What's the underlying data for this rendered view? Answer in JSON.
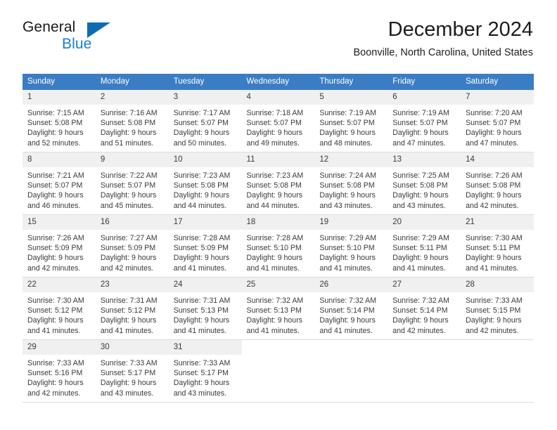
{
  "brand": {
    "name_part1": "General",
    "name_part2": "Blue",
    "accent_color": "#1a7fd4",
    "flag_color": "#0d6cb5"
  },
  "header": {
    "title": "December 2024",
    "subtitle": "Boonville, North Carolina, United States"
  },
  "theme": {
    "header_blue": "#3b7dc4",
    "daynum_bg": "#f0f0f0",
    "text": "#3a3a3a"
  },
  "weekday_headers": [
    "Sunday",
    "Monday",
    "Tuesday",
    "Wednesday",
    "Thursday",
    "Friday",
    "Saturday"
  ],
  "weeks": [
    {
      "days": [
        {
          "num": "1",
          "sunrise": "Sunrise: 7:15 AM",
          "sunset": "Sunset: 5:08 PM",
          "daylight1": "Daylight: 9 hours",
          "daylight2": "and 52 minutes."
        },
        {
          "num": "2",
          "sunrise": "Sunrise: 7:16 AM",
          "sunset": "Sunset: 5:08 PM",
          "daylight1": "Daylight: 9 hours",
          "daylight2": "and 51 minutes."
        },
        {
          "num": "3",
          "sunrise": "Sunrise: 7:17 AM",
          "sunset": "Sunset: 5:07 PM",
          "daylight1": "Daylight: 9 hours",
          "daylight2": "and 50 minutes."
        },
        {
          "num": "4",
          "sunrise": "Sunrise: 7:18 AM",
          "sunset": "Sunset: 5:07 PM",
          "daylight1": "Daylight: 9 hours",
          "daylight2": "and 49 minutes."
        },
        {
          "num": "5",
          "sunrise": "Sunrise: 7:19 AM",
          "sunset": "Sunset: 5:07 PM",
          "daylight1": "Daylight: 9 hours",
          "daylight2": "and 48 minutes."
        },
        {
          "num": "6",
          "sunrise": "Sunrise: 7:19 AM",
          "sunset": "Sunset: 5:07 PM",
          "daylight1": "Daylight: 9 hours",
          "daylight2": "and 47 minutes."
        },
        {
          "num": "7",
          "sunrise": "Sunrise: 7:20 AM",
          "sunset": "Sunset: 5:07 PM",
          "daylight1": "Daylight: 9 hours",
          "daylight2": "and 47 minutes."
        }
      ]
    },
    {
      "days": [
        {
          "num": "8",
          "sunrise": "Sunrise: 7:21 AM",
          "sunset": "Sunset: 5:07 PM",
          "daylight1": "Daylight: 9 hours",
          "daylight2": "and 46 minutes."
        },
        {
          "num": "9",
          "sunrise": "Sunrise: 7:22 AM",
          "sunset": "Sunset: 5:07 PM",
          "daylight1": "Daylight: 9 hours",
          "daylight2": "and 45 minutes."
        },
        {
          "num": "10",
          "sunrise": "Sunrise: 7:23 AM",
          "sunset": "Sunset: 5:08 PM",
          "daylight1": "Daylight: 9 hours",
          "daylight2": "and 44 minutes."
        },
        {
          "num": "11",
          "sunrise": "Sunrise: 7:23 AM",
          "sunset": "Sunset: 5:08 PM",
          "daylight1": "Daylight: 9 hours",
          "daylight2": "and 44 minutes."
        },
        {
          "num": "12",
          "sunrise": "Sunrise: 7:24 AM",
          "sunset": "Sunset: 5:08 PM",
          "daylight1": "Daylight: 9 hours",
          "daylight2": "and 43 minutes."
        },
        {
          "num": "13",
          "sunrise": "Sunrise: 7:25 AM",
          "sunset": "Sunset: 5:08 PM",
          "daylight1": "Daylight: 9 hours",
          "daylight2": "and 43 minutes."
        },
        {
          "num": "14",
          "sunrise": "Sunrise: 7:26 AM",
          "sunset": "Sunset: 5:08 PM",
          "daylight1": "Daylight: 9 hours",
          "daylight2": "and 42 minutes."
        }
      ]
    },
    {
      "days": [
        {
          "num": "15",
          "sunrise": "Sunrise: 7:26 AM",
          "sunset": "Sunset: 5:09 PM",
          "daylight1": "Daylight: 9 hours",
          "daylight2": "and 42 minutes."
        },
        {
          "num": "16",
          "sunrise": "Sunrise: 7:27 AM",
          "sunset": "Sunset: 5:09 PM",
          "daylight1": "Daylight: 9 hours",
          "daylight2": "and 42 minutes."
        },
        {
          "num": "17",
          "sunrise": "Sunrise: 7:28 AM",
          "sunset": "Sunset: 5:09 PM",
          "daylight1": "Daylight: 9 hours",
          "daylight2": "and 41 minutes."
        },
        {
          "num": "18",
          "sunrise": "Sunrise: 7:28 AM",
          "sunset": "Sunset: 5:10 PM",
          "daylight1": "Daylight: 9 hours",
          "daylight2": "and 41 minutes."
        },
        {
          "num": "19",
          "sunrise": "Sunrise: 7:29 AM",
          "sunset": "Sunset: 5:10 PM",
          "daylight1": "Daylight: 9 hours",
          "daylight2": "and 41 minutes."
        },
        {
          "num": "20",
          "sunrise": "Sunrise: 7:29 AM",
          "sunset": "Sunset: 5:11 PM",
          "daylight1": "Daylight: 9 hours",
          "daylight2": "and 41 minutes."
        },
        {
          "num": "21",
          "sunrise": "Sunrise: 7:30 AM",
          "sunset": "Sunset: 5:11 PM",
          "daylight1": "Daylight: 9 hours",
          "daylight2": "and 41 minutes."
        }
      ]
    },
    {
      "days": [
        {
          "num": "22",
          "sunrise": "Sunrise: 7:30 AM",
          "sunset": "Sunset: 5:12 PM",
          "daylight1": "Daylight: 9 hours",
          "daylight2": "and 41 minutes."
        },
        {
          "num": "23",
          "sunrise": "Sunrise: 7:31 AM",
          "sunset": "Sunset: 5:12 PM",
          "daylight1": "Daylight: 9 hours",
          "daylight2": "and 41 minutes."
        },
        {
          "num": "24",
          "sunrise": "Sunrise: 7:31 AM",
          "sunset": "Sunset: 5:13 PM",
          "daylight1": "Daylight: 9 hours",
          "daylight2": "and 41 minutes."
        },
        {
          "num": "25",
          "sunrise": "Sunrise: 7:32 AM",
          "sunset": "Sunset: 5:13 PM",
          "daylight1": "Daylight: 9 hours",
          "daylight2": "and 41 minutes."
        },
        {
          "num": "26",
          "sunrise": "Sunrise: 7:32 AM",
          "sunset": "Sunset: 5:14 PM",
          "daylight1": "Daylight: 9 hours",
          "daylight2": "and 41 minutes."
        },
        {
          "num": "27",
          "sunrise": "Sunrise: 7:32 AM",
          "sunset": "Sunset: 5:14 PM",
          "daylight1": "Daylight: 9 hours",
          "daylight2": "and 42 minutes."
        },
        {
          "num": "28",
          "sunrise": "Sunrise: 7:33 AM",
          "sunset": "Sunset: 5:15 PM",
          "daylight1": "Daylight: 9 hours",
          "daylight2": "and 42 minutes."
        }
      ]
    },
    {
      "days": [
        {
          "num": "29",
          "sunrise": "Sunrise: 7:33 AM",
          "sunset": "Sunset: 5:16 PM",
          "daylight1": "Daylight: 9 hours",
          "daylight2": "and 42 minutes."
        },
        {
          "num": "30",
          "sunrise": "Sunrise: 7:33 AM",
          "sunset": "Sunset: 5:17 PM",
          "daylight1": "Daylight: 9 hours",
          "daylight2": "and 43 minutes."
        },
        {
          "num": "31",
          "sunrise": "Sunrise: 7:33 AM",
          "sunset": "Sunset: 5:17 PM",
          "daylight1": "Daylight: 9 hours",
          "daylight2": "and 43 minutes."
        },
        {
          "num": "",
          "sunrise": "",
          "sunset": "",
          "daylight1": "",
          "daylight2": ""
        },
        {
          "num": "",
          "sunrise": "",
          "sunset": "",
          "daylight1": "",
          "daylight2": ""
        },
        {
          "num": "",
          "sunrise": "",
          "sunset": "",
          "daylight1": "",
          "daylight2": ""
        },
        {
          "num": "",
          "sunrise": "",
          "sunset": "",
          "daylight1": "",
          "daylight2": ""
        }
      ]
    }
  ]
}
